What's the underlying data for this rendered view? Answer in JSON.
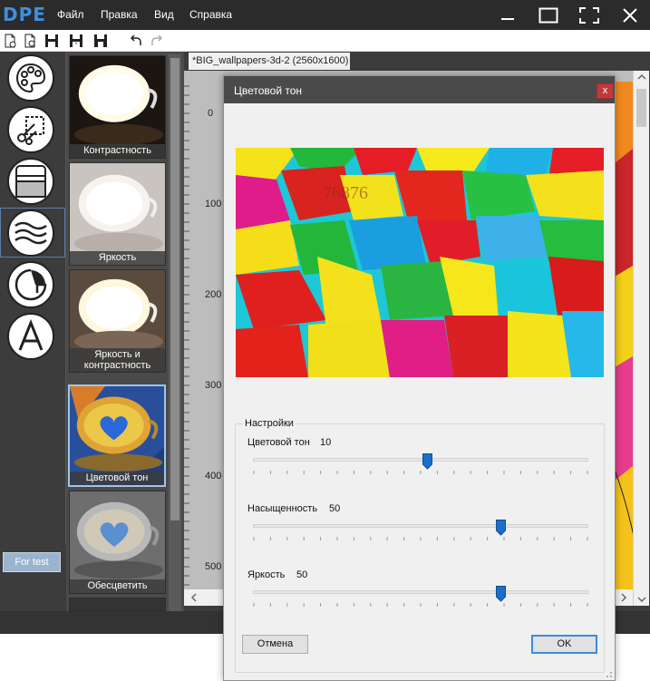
{
  "app": {
    "logo": "DPE",
    "menu": [
      "Файл",
      "Правка",
      "Вид",
      "Справка"
    ]
  },
  "tools": {
    "icons": [
      "palette-icon",
      "crop-scissors-icon",
      "texture-icon",
      "waves-icon",
      "sticker-icon",
      "text-icon"
    ],
    "selected_index": 3,
    "test_button": "For test"
  },
  "effects": {
    "items": [
      {
        "label": "Контрастность"
      },
      {
        "label": "Яркость"
      },
      {
        "label_line1": "Яркость и",
        "label_line2": "контрастность"
      },
      {
        "label": "Цветовой тон"
      },
      {
        "label": "Обесцветить"
      }
    ],
    "selected_index": 3
  },
  "document": {
    "tab_title": "*BIG_wallpapers-3d-2 (2560x1600)",
    "ruler_labels": [
      "0",
      "100",
      "200",
      "300",
      "400",
      "500"
    ]
  },
  "dialog": {
    "title": "Цветовой тон",
    "close_label": "x",
    "preview_watermark": "76876",
    "group_title": "Настройки",
    "sliders": [
      {
        "label": "Цветовой тон",
        "value": "10",
        "position_fraction": 0.52
      },
      {
        "label": "Насыщенность",
        "value": "50",
        "position_fraction": 0.74
      },
      {
        "label": "Яркость",
        "value": "50",
        "position_fraction": 0.74
      }
    ],
    "cancel_label": "Отмена",
    "ok_label": "OK"
  },
  "colors": {
    "titlebar": "#2b2b2b",
    "logo": "#3d8fe0",
    "accent": "#1a6fc9",
    "close_red": "#c13a3a"
  }
}
